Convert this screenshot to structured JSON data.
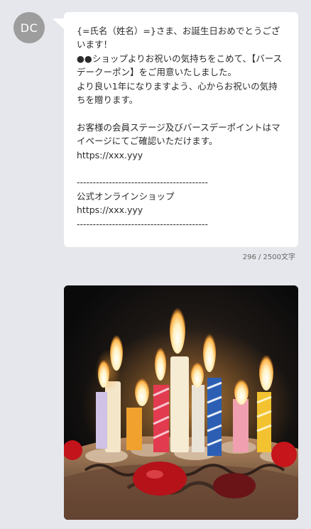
{
  "sender": {
    "initials": "DC"
  },
  "message": {
    "text": "{=氏名（姓名）=}さま、お誕生日おめでとうございます！\n●●ショップよりお祝いの気持ちをこめて、【バースデークーポン】をご用意いたしました。\nより良い1年になりますよう、心からお祝いの気持ちを贈ります。\n\nお客様の会員ステージ及びバースデーポイントはマイページにてご確認いただけます。\nhttps://xxx.yyy\n\n-----------------------------------------\n公式オンラインショップ\nhttps://xxx.yyy\n-----------------------------------------"
  },
  "counter": {
    "text": "296 / 2500文字"
  },
  "image": {
    "subject": "birthday-cake-with-candles"
  },
  "colors": {
    "background": "#e5e7ec",
    "avatar": "#9d9d9d",
    "bubble": "#ffffff"
  }
}
